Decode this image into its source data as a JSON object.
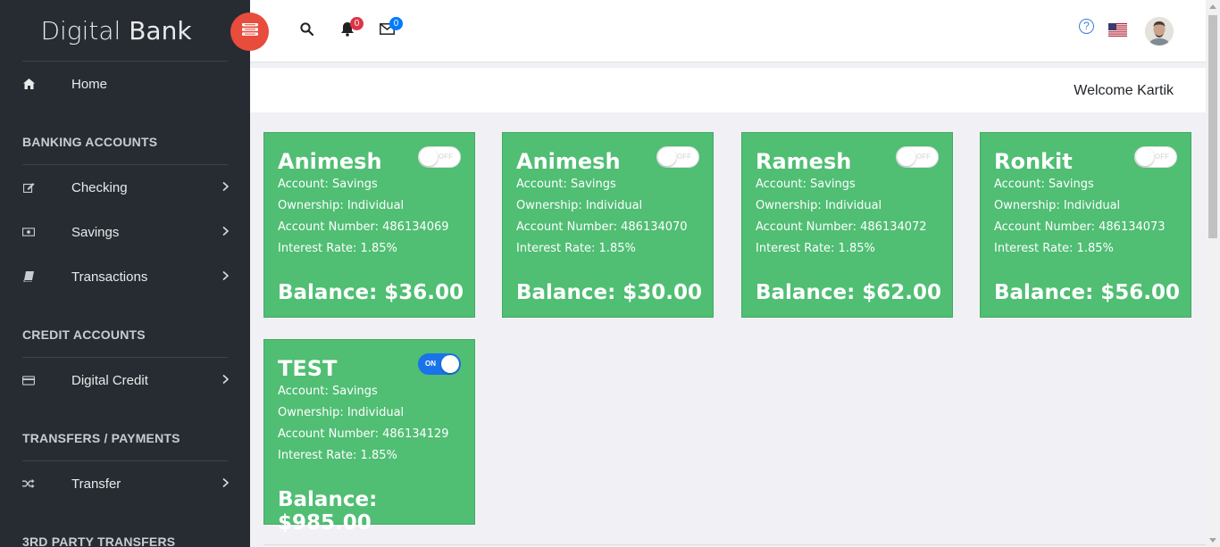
{
  "brand": {
    "light": "Digital",
    "bold": "Bank"
  },
  "sidebar": {
    "home": "Home",
    "sections": {
      "banking": "BANKING ACCOUNTS",
      "credit": "CREDIT ACCOUNTS",
      "transfers": "TRANSFERS / PAYMENTS",
      "third_party": "3RD PARTY TRANSFERS"
    },
    "items": {
      "checking": "Checking",
      "savings": "Savings",
      "transactions": "Transactions",
      "digital_credit": "Digital Credit",
      "transfer": "Transfer"
    }
  },
  "topbar": {
    "notifications_count": "0",
    "messages_count": "0",
    "help_label": "?"
  },
  "welcome": "Welcome Kartik",
  "accounts": [
    {
      "name": "Animesh",
      "account": "Account: Savings",
      "ownership": "Ownership: Individual",
      "number": "Account Number: 486134069",
      "rate": "Interest Rate: 1.85%",
      "balance": "Balance: $36.00",
      "toggle": "OFF"
    },
    {
      "name": "Animesh",
      "account": "Account: Savings",
      "ownership": "Ownership: Individual",
      "number": "Account Number: 486134070",
      "rate": "Interest Rate: 1.85%",
      "balance": "Balance: $30.00",
      "toggle": "OFF"
    },
    {
      "name": "Ramesh",
      "account": "Account: Savings",
      "ownership": "Ownership: Individual",
      "number": "Account Number: 486134072",
      "rate": "Interest Rate: 1.85%",
      "balance": "Balance: $62.00",
      "toggle": "OFF"
    },
    {
      "name": "Ronkit",
      "account": "Account: Savings",
      "ownership": "Ownership: Individual",
      "number": "Account Number: 486134073",
      "rate": "Interest Rate: 1.85%",
      "balance": "Balance: $56.00",
      "toggle": "OFF"
    },
    {
      "name": "TEST",
      "account": "Account: Savings",
      "ownership": "Ownership: Individual",
      "number": "Account Number: 486134129",
      "rate": "Interest Rate: 1.85%",
      "balance": "Balance: $985.00",
      "toggle": "ON"
    }
  ],
  "colors": {
    "card": "#50be73",
    "sidebar": "#272c33",
    "toggle_btn": "#e74c3c",
    "toggle_on": "#1a73e8"
  },
  "icons": [
    "home-icon",
    "edit-icon",
    "money-icon",
    "book-icon",
    "credit-card-icon",
    "shuffle-icon",
    "chevron-right-icon",
    "menu-toggle-icon",
    "search-icon",
    "bell-icon",
    "envelope-icon",
    "help-icon",
    "us-flag-icon",
    "avatar"
  ]
}
